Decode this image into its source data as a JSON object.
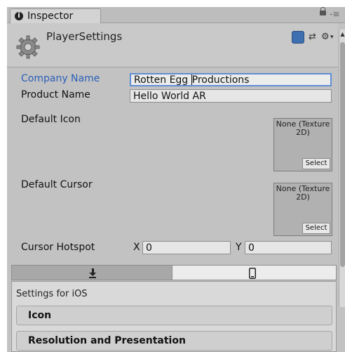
{
  "window": {
    "tab_label": "Inspector",
    "tab_info_glyph": "i",
    "menu_glyph": "-≡"
  },
  "header": {
    "title": "PlayerSettings",
    "icons": [
      "book-help-icon",
      "sliders-icon",
      "gear-icon"
    ],
    "sliders_glyph": "⇄",
    "gear_glyph": "⚙",
    "dropdown_glyph": "▾"
  },
  "fields": {
    "company_label": "Company Name",
    "company_value_before_caret": "Rotten Egg ",
    "company_value_after_caret": "Productions",
    "product_label": "Product Name",
    "product_value": "Hello World AR",
    "default_icon_label": "Default Icon",
    "default_icon_texture": "None (Texture 2D)",
    "default_icon_select": "Select",
    "default_cursor_label": "Default Cursor",
    "default_cursor_texture": "None (Texture 2D)",
    "default_cursor_select": "Select",
    "hotspot_label": "Cursor Hotspot",
    "hotspot_x_label": "X",
    "hotspot_x_value": "0",
    "hotspot_y_label": "Y",
    "hotspot_y_value": "0"
  },
  "platforms": {
    "tabs": [
      "download-standalone-icon",
      "mobile-device-icon"
    ],
    "selected": "mobile-device-icon"
  },
  "ios_panel": {
    "title": "Settings for iOS",
    "sections": [
      "Icon",
      "Resolution and Presentation"
    ]
  },
  "colors": {
    "accent_label": "#2c5fb8",
    "focus_border": "#5f8fd3",
    "window_bg": "#c2c2c2"
  }
}
